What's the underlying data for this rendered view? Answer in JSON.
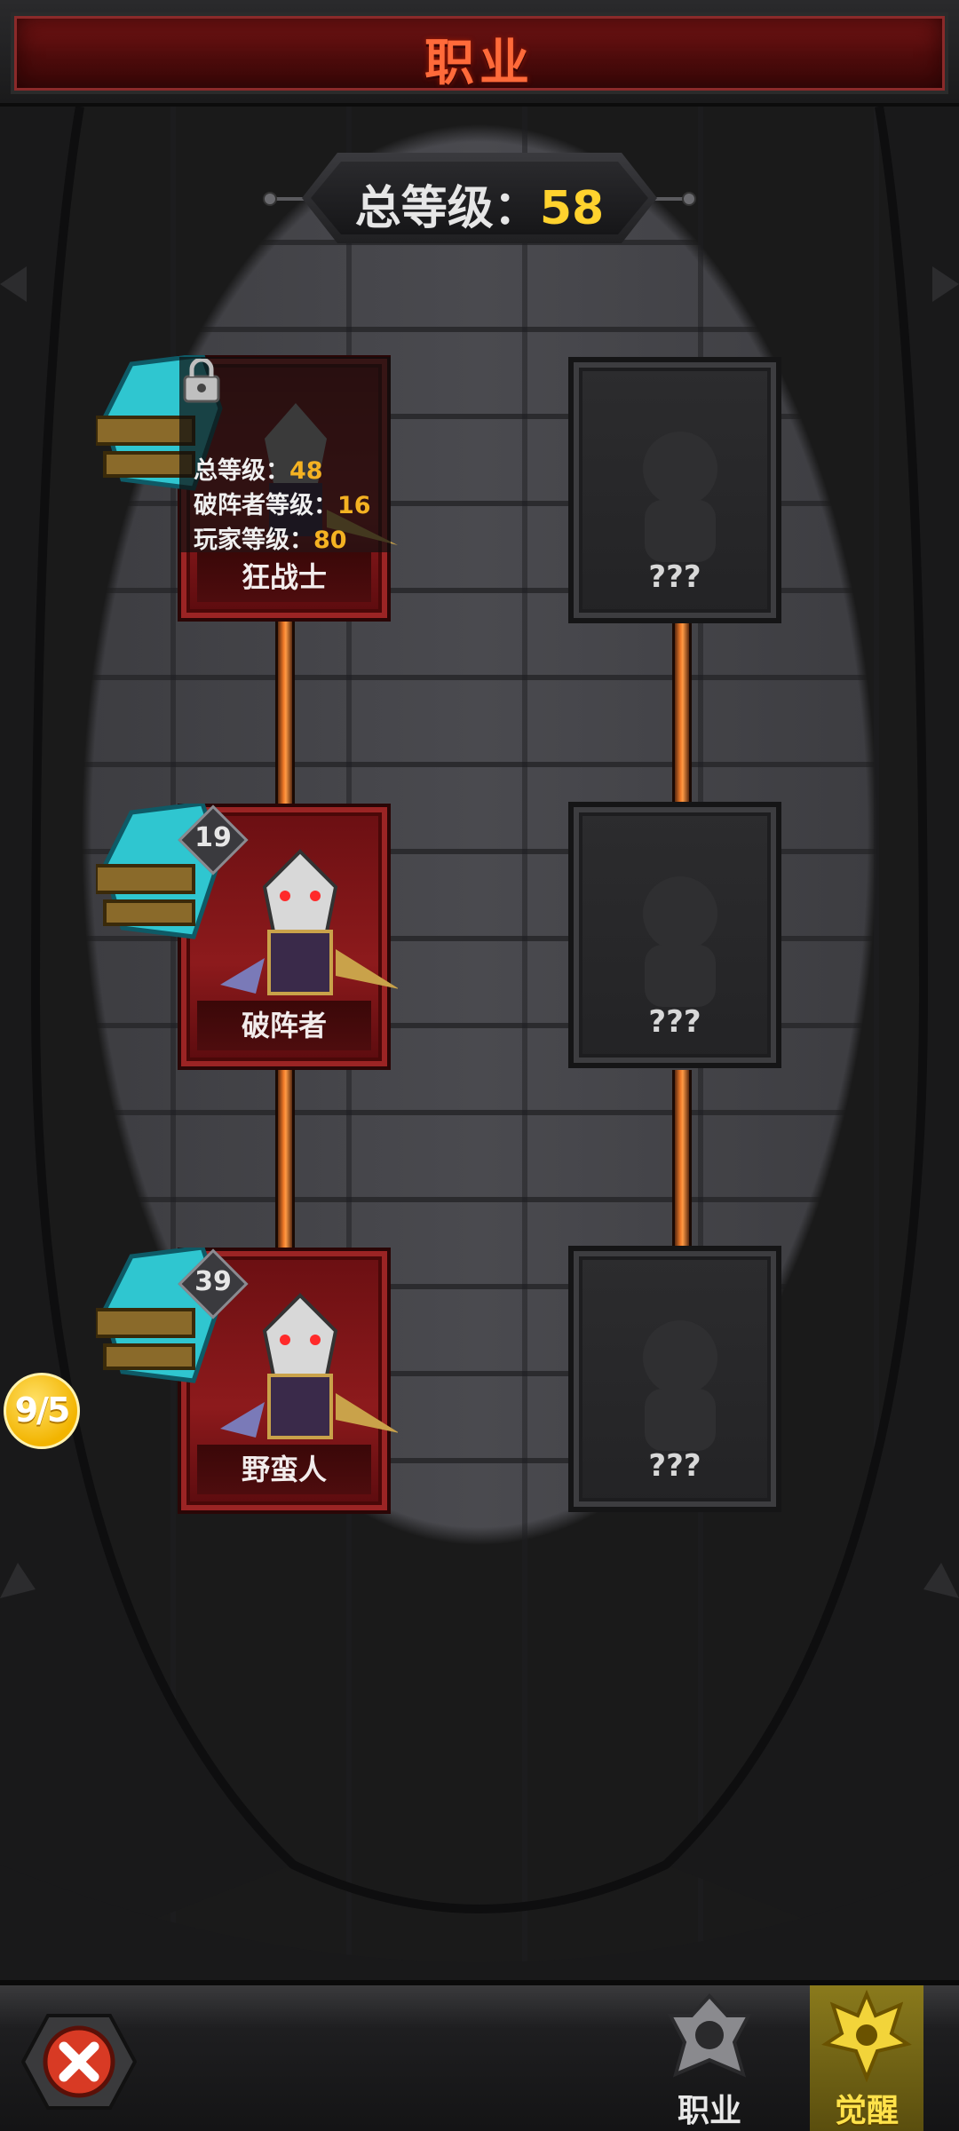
{
  "header": {
    "title": "职业"
  },
  "summary": {
    "total_level_label": "总等级：",
    "total_level_value": "58"
  },
  "classes": [
    {
      "name": "狂战士",
      "locked": true,
      "requirements": [
        {
          "label": "总等级：",
          "value": "48"
        },
        {
          "label": "破阵者等级：",
          "value": "16"
        },
        {
          "label": "玩家等级：",
          "value": "80"
        }
      ]
    },
    {
      "name": "破阵者",
      "level": "19",
      "locked": false
    },
    {
      "name": "野蛮人",
      "level": "39",
      "locked": false
    }
  ],
  "unknown_classes": [
    {
      "name": "???"
    },
    {
      "name": "???"
    },
    {
      "name": "???"
    }
  ],
  "side_badge": {
    "text": "9/5"
  },
  "bottom_nav": {
    "close_icon": "close-icon",
    "tabs": [
      {
        "label": "职业",
        "active": false,
        "icon": "class-emblem-icon"
      },
      {
        "label": "觉醒",
        "active": true,
        "icon": "awaken-crown-icon"
      }
    ]
  },
  "colors": {
    "accent_red": "#8d1a1c",
    "gold": "#ffd22e",
    "connector_orange": "#f07a28",
    "value_orange": "#f4b222"
  }
}
